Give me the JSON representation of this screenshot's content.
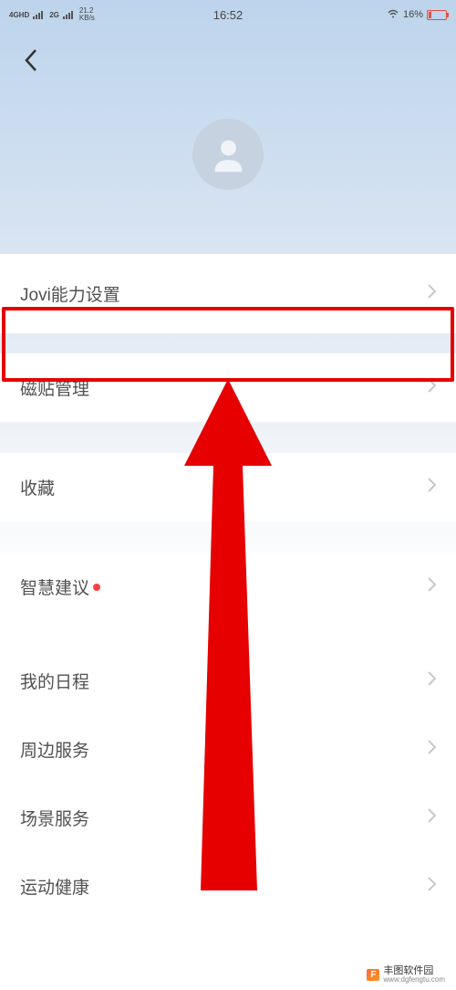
{
  "status_bar": {
    "network_type_1": "4GHD",
    "network_type_2": "2G",
    "speed_value": "21.2",
    "speed_unit": "KB/s",
    "time": "16:52",
    "battery_percent": "16%"
  },
  "menu": {
    "items": [
      {
        "label": "Jovi能力设置",
        "has_dot": false
      },
      {
        "label": "磁贴管理",
        "has_dot": false
      },
      {
        "label": "收藏",
        "has_dot": false
      },
      {
        "label": "智慧建议",
        "has_dot": true
      },
      {
        "label": "我的日程",
        "has_dot": false
      },
      {
        "label": "周边服务",
        "has_dot": false
      },
      {
        "label": "场景服务",
        "has_dot": false
      },
      {
        "label": "运动健康",
        "has_dot": false
      }
    ]
  },
  "annotation": {
    "highlight_index": 0,
    "highlight_color": "#e60000",
    "arrow_color": "#e60000"
  },
  "watermark": {
    "logo": "F",
    "name": "丰图软件园",
    "url": "www.dgfengtu.com"
  }
}
